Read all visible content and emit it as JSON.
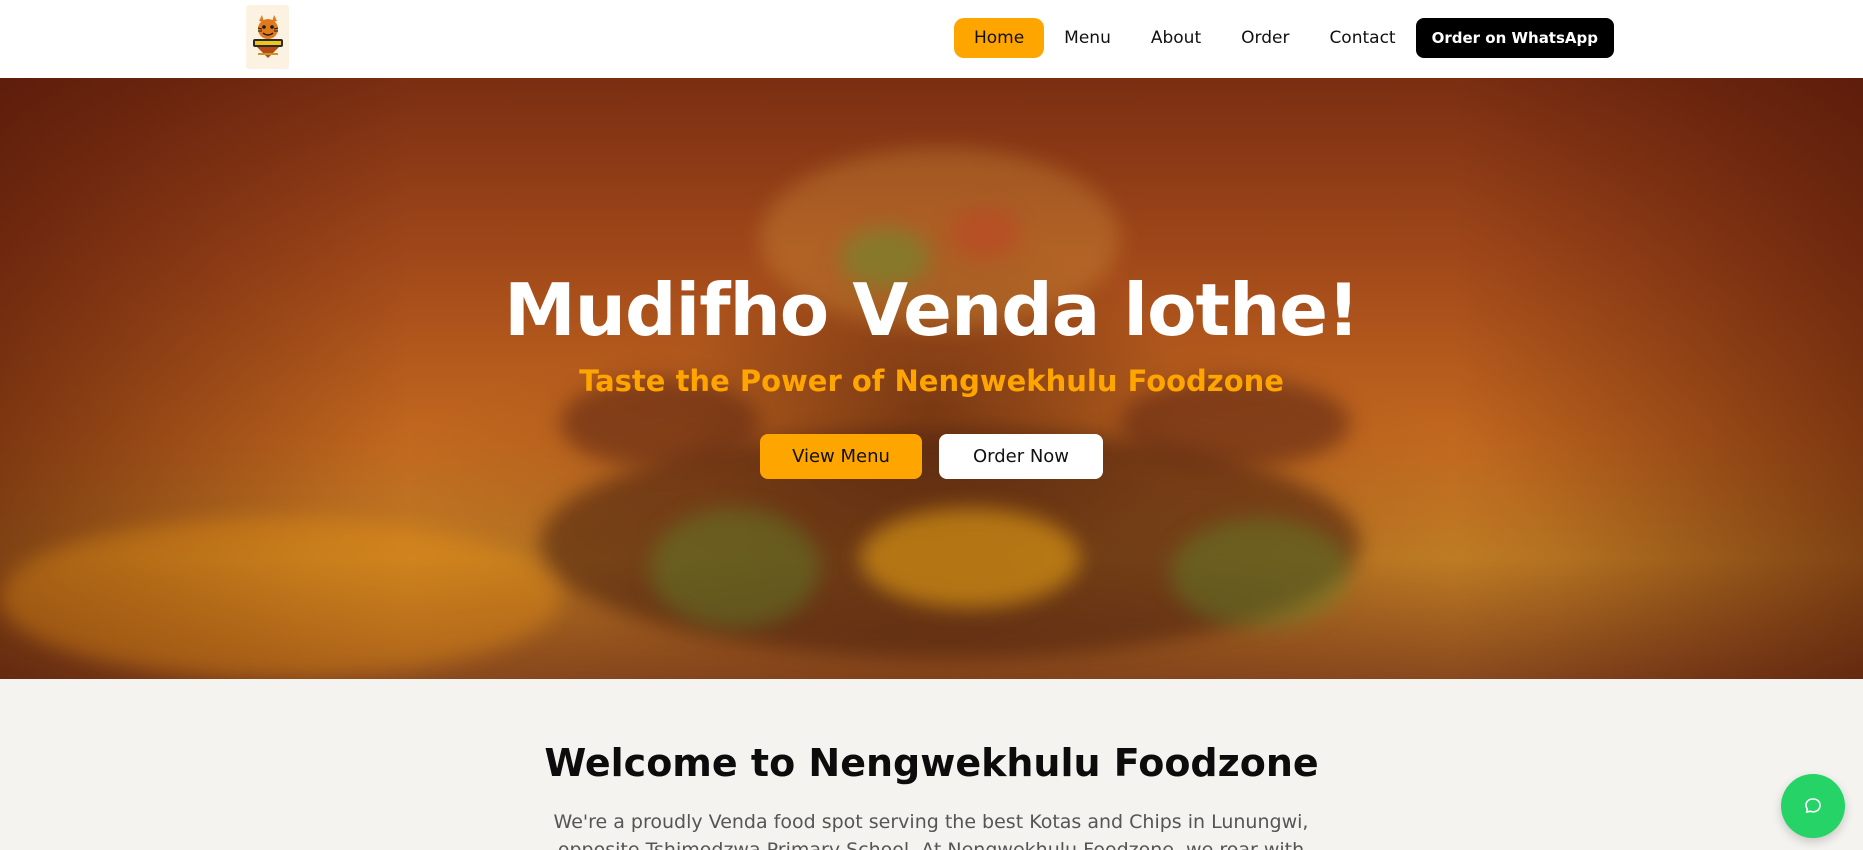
{
  "header": {
    "logo_alt": "Nengwekhulu Foodzone logo",
    "nav": {
      "home": "Home",
      "menu": "Menu",
      "about": "About",
      "order": "Order",
      "contact": "Contact"
    },
    "whatsapp_button": "Order on WhatsApp"
  },
  "hero": {
    "title": "Mudifho Venda lothe!",
    "subtitle": "Taste the Power of Nengwekhulu Foodzone",
    "view_menu": "View Menu",
    "order_now": "Order Now"
  },
  "welcome": {
    "title": "Welcome to Nengwekhulu Foodzone",
    "text": "We're a proudly Venda food spot serving the best Kotas and Chips in Lunungwi, opposite Tshimodzwa Primary School. At Nengwekhulu Foodzone, we roar with flavour"
  },
  "colors": {
    "accent": "#ffa500",
    "dark": "#000000",
    "whatsapp": "#25d366",
    "section_bg": "#f4f3ef"
  },
  "icons": {
    "chat": "chat-bubble-icon",
    "logo": "tiger-mascot-icon"
  }
}
